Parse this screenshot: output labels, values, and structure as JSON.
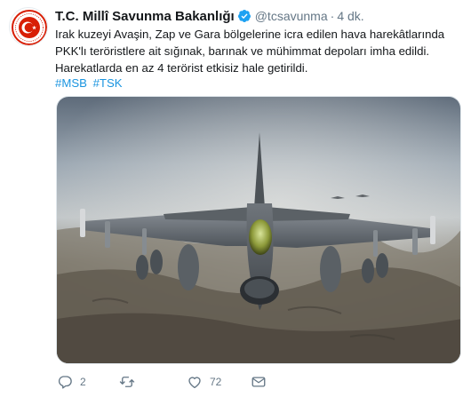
{
  "tweet": {
    "author_name": "T.C. Millî Savunma Bakanlığı",
    "handle": "@tcsavunma",
    "separator": "·",
    "time": "4 dk.",
    "text": "Irak kuzeyi Avaşin, Zap ve Gara bölgelerine icra edilen hava harekâtlarında PKK'lı teröristlere ait sığınak, barınak ve mühimmat depoları imha edildi. Harekatlarda en az 4 terörist etkisiz hale getirildi.",
    "hashtags": [
      "#MSB",
      "#TSK"
    ]
  },
  "actions": {
    "reply_count": "2",
    "retweet_count": "",
    "like_count": "72"
  },
  "icons": {
    "verified": "verified-badge-icon",
    "reply": "reply-icon",
    "retweet": "retweet-icon",
    "like": "heart-icon",
    "dm": "envelope-icon"
  },
  "colors": {
    "link": "#1b95e0",
    "muted": "#657786",
    "verified": "#1da1f2",
    "logo_red": "#d81e05"
  }
}
